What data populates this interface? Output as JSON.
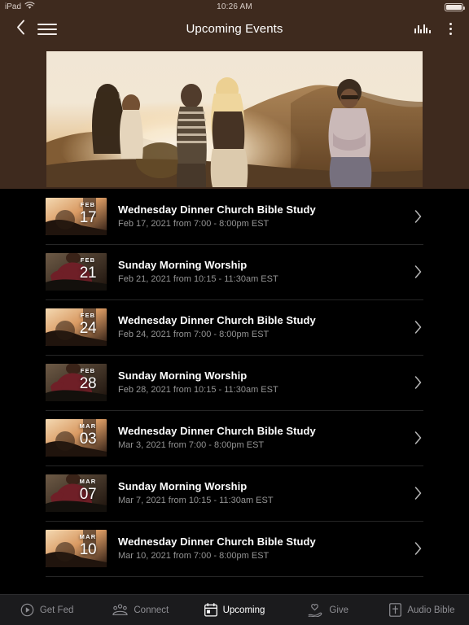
{
  "status_bar": {
    "device": "iPad",
    "wifi_icon": "wifi-icon",
    "time": "10:26 AM",
    "battery_icon": "battery-full-icon"
  },
  "nav": {
    "back_icon": "chevron-left-icon",
    "menu_icon": "hamburger-menu-icon",
    "title": "Upcoming Events",
    "audio_icon": "audio-bars-icon",
    "overflow_icon": "more-vertical-icon"
  },
  "hero": {
    "alt": "group-of-people-at-sunset-banner"
  },
  "events": [
    {
      "month": "FEB",
      "day": "17",
      "title": "Wednesday Dinner Church Bible Study",
      "subtitle": "Feb 17, 2021 from 7:00 - 8:00pm EST",
      "thumb": "sunset",
      "chevron_icon": "chevron-right-icon"
    },
    {
      "month": "FEB",
      "day": "21",
      "title": "Sunday Morning Worship",
      "subtitle": "Feb 21, 2021 from 10:15 - 11:30am EST",
      "thumb": "worship",
      "chevron_icon": "chevron-right-icon"
    },
    {
      "month": "FEB",
      "day": "24",
      "title": "Wednesday Dinner Church Bible Study",
      "subtitle": "Feb 24, 2021 from 7:00 - 8:00pm EST",
      "thumb": "sunset",
      "chevron_icon": "chevron-right-icon"
    },
    {
      "month": "FEB",
      "day": "28",
      "title": "Sunday Morning Worship",
      "subtitle": "Feb 28, 2021 from 10:15 - 11:30am EST",
      "thumb": "worship",
      "chevron_icon": "chevron-right-icon"
    },
    {
      "month": "MAR",
      "day": "03",
      "title": "Wednesday Dinner Church Bible Study",
      "subtitle": "Mar 3, 2021 from 7:00 - 8:00pm EST",
      "thumb": "sunset",
      "chevron_icon": "chevron-right-icon"
    },
    {
      "month": "MAR",
      "day": "07",
      "title": "Sunday Morning Worship",
      "subtitle": "Mar 7, 2021 from 10:15 - 11:30am EST",
      "thumb": "worship",
      "chevron_icon": "chevron-right-icon"
    },
    {
      "month": "MAR",
      "day": "10",
      "title": "Wednesday Dinner Church Bible Study",
      "subtitle": "Mar 10, 2021 from 7:00 - 8:00pm EST",
      "thumb": "sunset",
      "chevron_icon": "chevron-right-icon"
    }
  ],
  "tabs": [
    {
      "label": "Get Fed",
      "icon": "play-circle-icon",
      "active": false
    },
    {
      "label": "Connect",
      "icon": "people-group-icon",
      "active": false
    },
    {
      "label": "Upcoming",
      "icon": "calendar-icon",
      "active": true
    },
    {
      "label": "Give",
      "icon": "hand-heart-icon",
      "active": false
    },
    {
      "label": "Audio Bible",
      "icon": "bible-book-icon",
      "active": false
    }
  ],
  "colors": {
    "header_brown": "#3e2a1e",
    "page_background": "#000000",
    "tabbar_background": "#1b1b1d",
    "active_tab": "#ffffff",
    "inactive_tab": "#8e8e93",
    "divider": "#262626",
    "subtitle_text": "#949494"
  }
}
